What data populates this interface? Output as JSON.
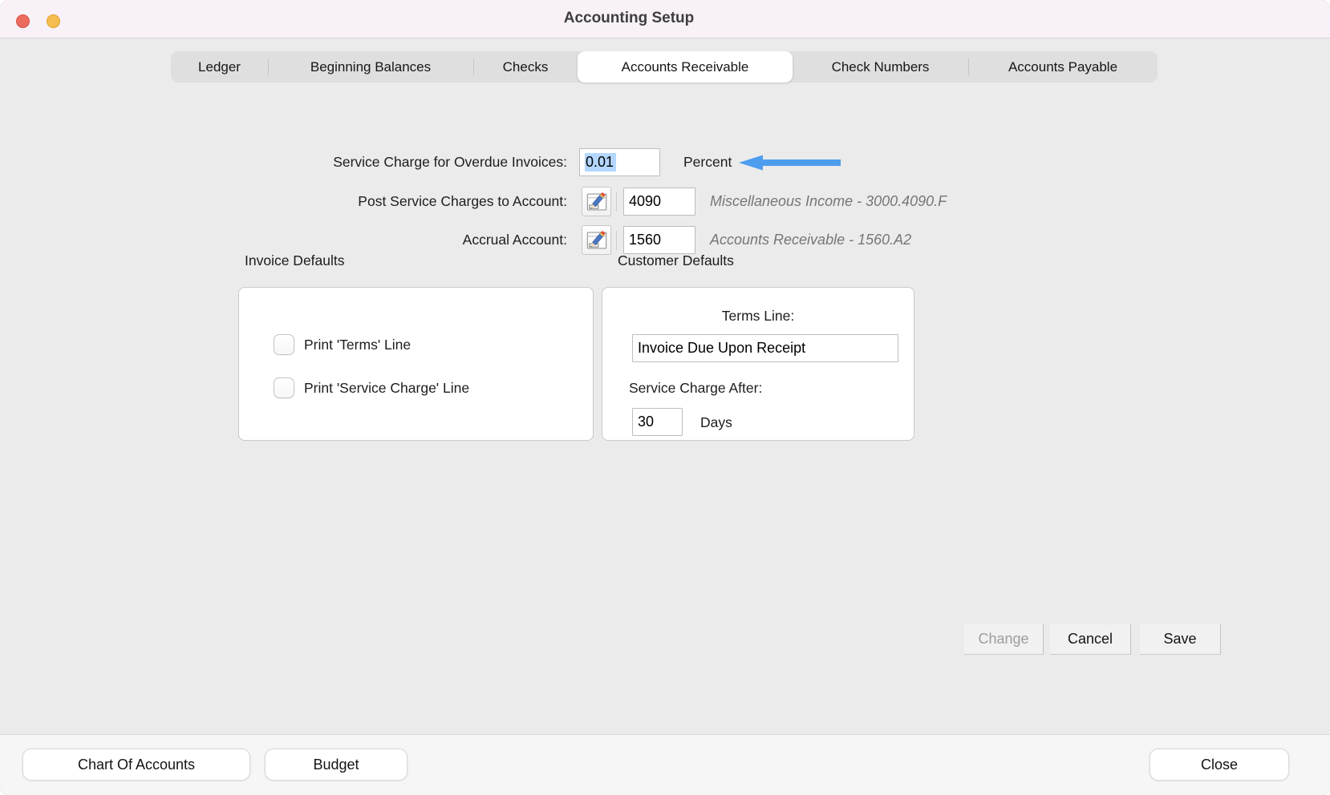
{
  "window": {
    "title": "Accounting Setup"
  },
  "tabs": {
    "items": [
      {
        "label": "Ledger",
        "selected": false
      },
      {
        "label": "Beginning Balances",
        "selected": false
      },
      {
        "label": "Checks",
        "selected": false
      },
      {
        "label": "Accounts Receivable",
        "selected": true
      },
      {
        "label": "Check Numbers",
        "selected": false
      },
      {
        "label": "Accounts Payable",
        "selected": false
      }
    ]
  },
  "form": {
    "service_charge": {
      "label": "Service Charge for Overdue Invoices:",
      "value": "0.01",
      "unit": "Percent"
    },
    "post_account": {
      "label": "Post Service Charges to Account:",
      "value": "4090",
      "description": "Miscellaneous Income - 3000.4090.F"
    },
    "accrual_account": {
      "label": "Accrual Account:",
      "value": "1560",
      "description": "Accounts Receivable - 1560.A2"
    }
  },
  "invoice_defaults": {
    "title": "Invoice Defaults",
    "checkboxes": [
      {
        "label": "Print 'Terms' Line",
        "checked": false
      },
      {
        "label": "Print 'Service Charge' Line",
        "checked": false
      }
    ]
  },
  "customer_defaults": {
    "title": "Customer Defaults",
    "terms_label": "Terms Line:",
    "terms_value": "Invoice Due Upon Receipt",
    "service_charge_after_label": "Service Charge After:",
    "days_value": "30",
    "days_unit": "Days"
  },
  "actions": {
    "change_label": "Change",
    "cancel_label": "Cancel",
    "save_label": "Save"
  },
  "footer": {
    "chart_of_accounts_label": "Chart Of Accounts",
    "budget_label": "Budget",
    "close_label": "Close"
  },
  "colors": {
    "arrow_blue": "#4d9def",
    "selection_blue": "#b3d7ff",
    "titlebar_pink": "#f8f1f7"
  }
}
